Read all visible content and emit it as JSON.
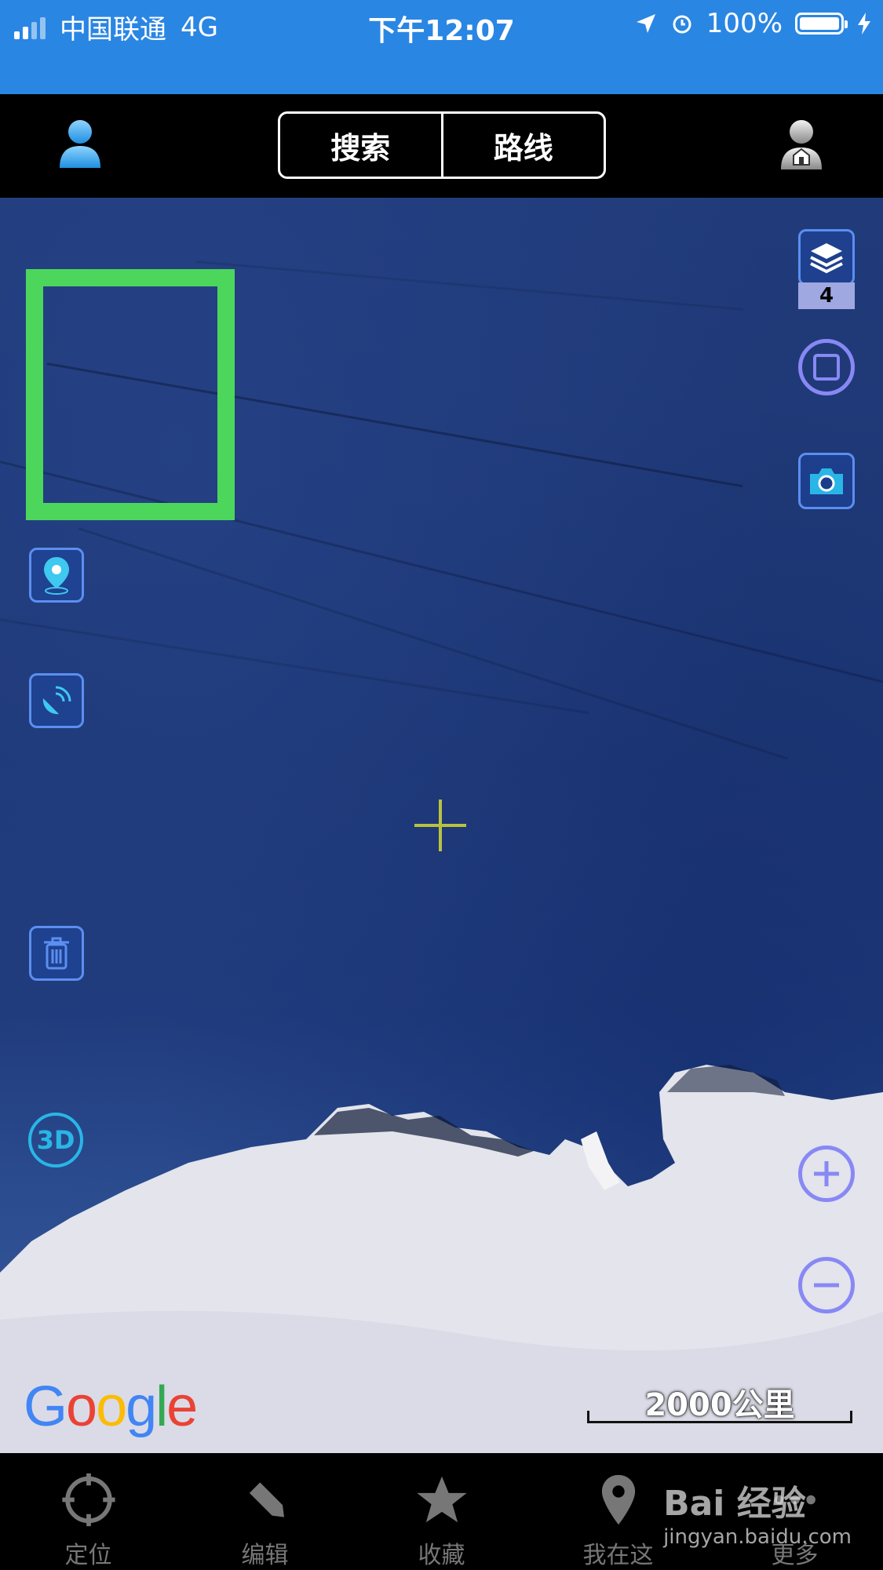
{
  "status_bar": {
    "carrier": "中国联通",
    "network": "4G",
    "time": "下午12:07",
    "battery": "100%"
  },
  "top_bar": {
    "search_label": "搜索",
    "route_label": "路线"
  },
  "map": {
    "layers_count": "4",
    "three_d_label": "3D",
    "scale_label": "2000公里",
    "logo_text": "Google",
    "highlight_color": "#4cd65c"
  },
  "tabs": [
    {
      "label": "定位",
      "icon": "locate-icon"
    },
    {
      "label": "编辑",
      "icon": "pencil-icon"
    },
    {
      "label": "收藏",
      "icon": "star-icon"
    },
    {
      "label": "我在这",
      "icon": "pin-icon"
    },
    {
      "label": "更多",
      "icon": "more-icon"
    }
  ],
  "watermark": {
    "brand": "Bai 经验",
    "url": "jingyan.baidu.com"
  },
  "colors": {
    "status_bar": "#2a86e3",
    "ocean": "#1d3673",
    "button_outline": "#5b8ff0",
    "zoom_outline": "#8888f5"
  }
}
